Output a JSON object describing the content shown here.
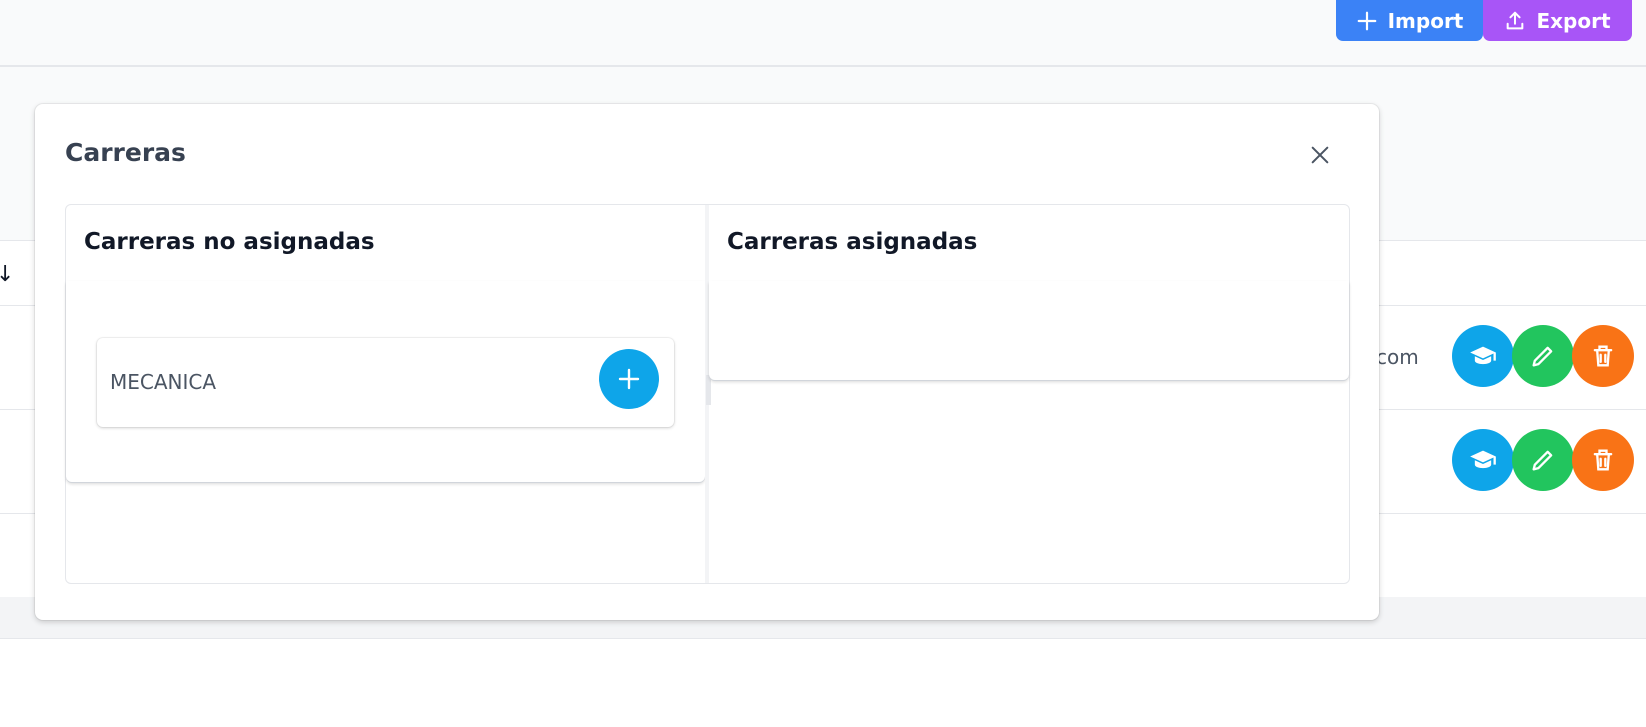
{
  "toolbar": {
    "import_label": "Import",
    "export_label": "Export",
    "import_color": "#3b82f6",
    "export_color": "#a855f7"
  },
  "background_table": {
    "sort_icon": "arrow-down-icon",
    "email_fragment": "com",
    "row_actions": [
      {
        "icon": "graduation-cap-icon",
        "color": "#0ea5e9"
      },
      {
        "icon": "pencil-icon",
        "color": "#22c55e"
      },
      {
        "icon": "trash-icon",
        "color": "#f97316"
      }
    ]
  },
  "modal": {
    "title": "Carreras",
    "close_icon": "close-icon",
    "left_panel": {
      "title": "Carreras no asignadas",
      "items": [
        {
          "label": "MECANICA",
          "action_icon": "plus-icon"
        }
      ]
    },
    "right_panel": {
      "title": "Carreras asignadas",
      "items": []
    }
  }
}
